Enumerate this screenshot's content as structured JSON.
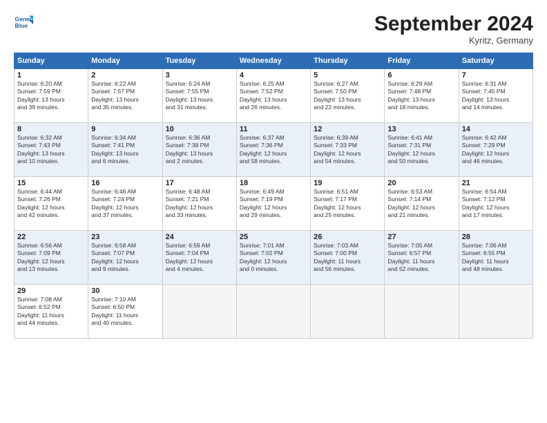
{
  "header": {
    "logo_line1": "General",
    "logo_line2": "Blue",
    "month": "September 2024",
    "location": "Kyritz, Germany"
  },
  "columns": [
    "Sunday",
    "Monday",
    "Tuesday",
    "Wednesday",
    "Thursday",
    "Friday",
    "Saturday"
  ],
  "weeks": [
    [
      {
        "day": "1",
        "info": "Sunrise: 6:20 AM\nSunset: 7:59 PM\nDaylight: 13 hours\nand 39 minutes."
      },
      {
        "day": "2",
        "info": "Sunrise: 6:22 AM\nSunset: 7:57 PM\nDaylight: 13 hours\nand 35 minutes."
      },
      {
        "day": "3",
        "info": "Sunrise: 6:24 AM\nSunset: 7:55 PM\nDaylight: 13 hours\nand 31 minutes."
      },
      {
        "day": "4",
        "info": "Sunrise: 6:25 AM\nSunset: 7:52 PM\nDaylight: 13 hours\nand 26 minutes."
      },
      {
        "day": "5",
        "info": "Sunrise: 6:27 AM\nSunset: 7:50 PM\nDaylight: 13 hours\nand 22 minutes."
      },
      {
        "day": "6",
        "info": "Sunrise: 6:29 AM\nSunset: 7:48 PM\nDaylight: 13 hours\nand 18 minutes."
      },
      {
        "day": "7",
        "info": "Sunrise: 6:31 AM\nSunset: 7:45 PM\nDaylight: 13 hours\nand 14 minutes."
      }
    ],
    [
      {
        "day": "8",
        "info": "Sunrise: 6:32 AM\nSunset: 7:43 PM\nDaylight: 13 hours\nand 10 minutes."
      },
      {
        "day": "9",
        "info": "Sunrise: 6:34 AM\nSunset: 7:41 PM\nDaylight: 13 hours\nand 6 minutes."
      },
      {
        "day": "10",
        "info": "Sunrise: 6:36 AM\nSunset: 7:38 PM\nDaylight: 13 hours\nand 2 minutes."
      },
      {
        "day": "11",
        "info": "Sunrise: 6:37 AM\nSunset: 7:36 PM\nDaylight: 12 hours\nand 58 minutes."
      },
      {
        "day": "12",
        "info": "Sunrise: 6:39 AM\nSunset: 7:33 PM\nDaylight: 12 hours\nand 54 minutes."
      },
      {
        "day": "13",
        "info": "Sunrise: 6:41 AM\nSunset: 7:31 PM\nDaylight: 12 hours\nand 50 minutes."
      },
      {
        "day": "14",
        "info": "Sunrise: 6:42 AM\nSunset: 7:29 PM\nDaylight: 12 hours\nand 46 minutes."
      }
    ],
    [
      {
        "day": "15",
        "info": "Sunrise: 6:44 AM\nSunset: 7:26 PM\nDaylight: 12 hours\nand 42 minutes."
      },
      {
        "day": "16",
        "info": "Sunrise: 6:46 AM\nSunset: 7:24 PM\nDaylight: 12 hours\nand 37 minutes."
      },
      {
        "day": "17",
        "info": "Sunrise: 6:48 AM\nSunset: 7:21 PM\nDaylight: 12 hours\nand 33 minutes."
      },
      {
        "day": "18",
        "info": "Sunrise: 6:49 AM\nSunset: 7:19 PM\nDaylight: 12 hours\nand 29 minutes."
      },
      {
        "day": "19",
        "info": "Sunrise: 6:51 AM\nSunset: 7:17 PM\nDaylight: 12 hours\nand 25 minutes."
      },
      {
        "day": "20",
        "info": "Sunrise: 6:53 AM\nSunset: 7:14 PM\nDaylight: 12 hours\nand 21 minutes."
      },
      {
        "day": "21",
        "info": "Sunrise: 6:54 AM\nSunset: 7:12 PM\nDaylight: 12 hours\nand 17 minutes."
      }
    ],
    [
      {
        "day": "22",
        "info": "Sunrise: 6:56 AM\nSunset: 7:09 PM\nDaylight: 12 hours\nand 13 minutes."
      },
      {
        "day": "23",
        "info": "Sunrise: 6:58 AM\nSunset: 7:07 PM\nDaylight: 12 hours\nand 9 minutes."
      },
      {
        "day": "24",
        "info": "Sunrise: 6:59 AM\nSunset: 7:04 PM\nDaylight: 12 hours\nand 4 minutes."
      },
      {
        "day": "25",
        "info": "Sunrise: 7:01 AM\nSunset: 7:02 PM\nDaylight: 12 hours\nand 0 minutes."
      },
      {
        "day": "26",
        "info": "Sunrise: 7:03 AM\nSunset: 7:00 PM\nDaylight: 11 hours\nand 56 minutes."
      },
      {
        "day": "27",
        "info": "Sunrise: 7:05 AM\nSunset: 6:57 PM\nDaylight: 11 hours\nand 52 minutes."
      },
      {
        "day": "28",
        "info": "Sunrise: 7:06 AM\nSunset: 6:55 PM\nDaylight: 11 hours\nand 48 minutes."
      }
    ],
    [
      {
        "day": "29",
        "info": "Sunrise: 7:08 AM\nSunset: 6:52 PM\nDaylight: 11 hours\nand 44 minutes."
      },
      {
        "day": "30",
        "info": "Sunrise: 7:10 AM\nSunset: 6:50 PM\nDaylight: 11 hours\nand 40 minutes."
      },
      {
        "day": "",
        "info": "",
        "empty": true
      },
      {
        "day": "",
        "info": "",
        "empty": true
      },
      {
        "day": "",
        "info": "",
        "empty": true
      },
      {
        "day": "",
        "info": "",
        "empty": true
      },
      {
        "day": "",
        "info": "",
        "empty": true
      }
    ]
  ]
}
